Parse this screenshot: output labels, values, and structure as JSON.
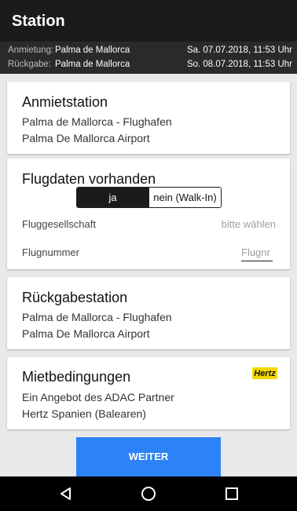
{
  "header": {
    "title": "Station"
  },
  "summary": {
    "pickup": {
      "label": "Anmietung:",
      "location": "Palma de Mallorca",
      "date": "Sa. 07.07.2018, 11:53 Uhr"
    },
    "return": {
      "label": "Rückgabe:",
      "location": "Palma de Mallorca",
      "date": "So. 08.07.2018, 11:53 Uhr"
    }
  },
  "pickup_station": {
    "title": "Anmietstation",
    "line1": "Palma de Mallorca - Flughafen",
    "line2": "Palma De Mallorca Airport"
  },
  "flight": {
    "title": "Flugdaten vorhanden",
    "toggle": {
      "yes": "ja",
      "no": "nein (Walk-In)",
      "selected": "ja"
    },
    "airline_label": "Fluggesellschaft",
    "airline_value": "bitte wählen",
    "flight_number_label": "Flugnummer",
    "flight_number_placeholder": "Flugnr"
  },
  "return_station": {
    "title": "Rückgabestation",
    "line1": "Palma de Mallorca - Flughafen",
    "line2": "Palma De Mallorca Airport"
  },
  "terms": {
    "title": "Mietbedingungen",
    "line1": "Ein Angebot des ADAC Partner",
    "line2": "Hertz Spanien (Balearen)",
    "brand_logo": "Hertz",
    "brand_color": "#f5d800"
  },
  "actions": {
    "continue_label": "WEITER"
  },
  "navbar": {
    "back_icon": "back-icon",
    "home_icon": "home-icon",
    "recent_icon": "recent-apps-icon"
  },
  "colors": {
    "accent": "#2d82f7",
    "topbar": "#1b1b1b"
  }
}
